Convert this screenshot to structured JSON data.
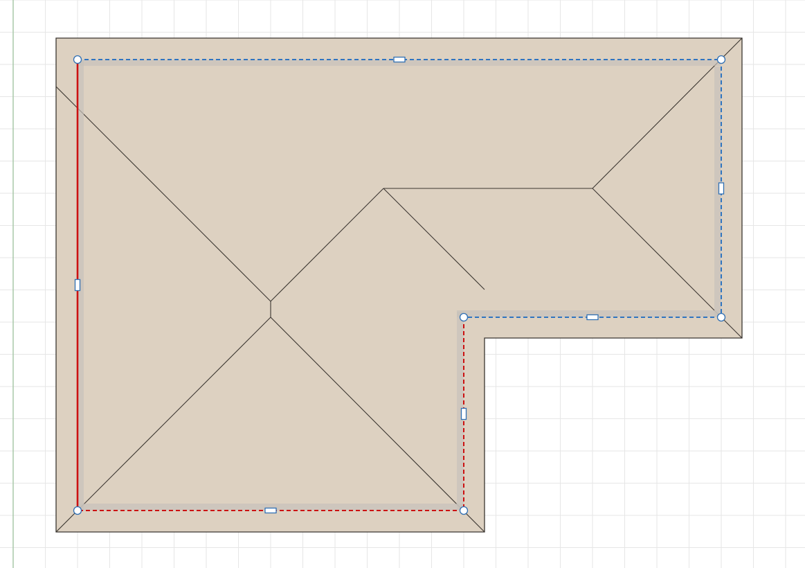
{
  "canvas": {
    "background_color": "#ffffff",
    "grid_color": "#e6e6e6",
    "axis_color": "#a8c8a8"
  },
  "roof": {
    "fill_color": "#ddd1c1",
    "outline_color": "#3a3530",
    "ridge_color": "#3a3530"
  },
  "footprint": {
    "wall_shadow_color": "#c7c2bb",
    "edge_colors": {
      "selected": "#cc1111",
      "gable": "#cc1111",
      "default": "#2f74c0"
    },
    "edges": [
      {
        "name": "edge-top",
        "state": "default"
      },
      {
        "name": "edge-right",
        "state": "default"
      },
      {
        "name": "edge-inner-bottom",
        "state": "default"
      },
      {
        "name": "edge-inner-left",
        "state": "gable"
      },
      {
        "name": "edge-bottom",
        "state": "gable"
      },
      {
        "name": "edge-left",
        "state": "selected"
      }
    ]
  },
  "handles": {
    "fill_color": "#ffffff",
    "stroke_color": "#2f6fb3"
  }
}
